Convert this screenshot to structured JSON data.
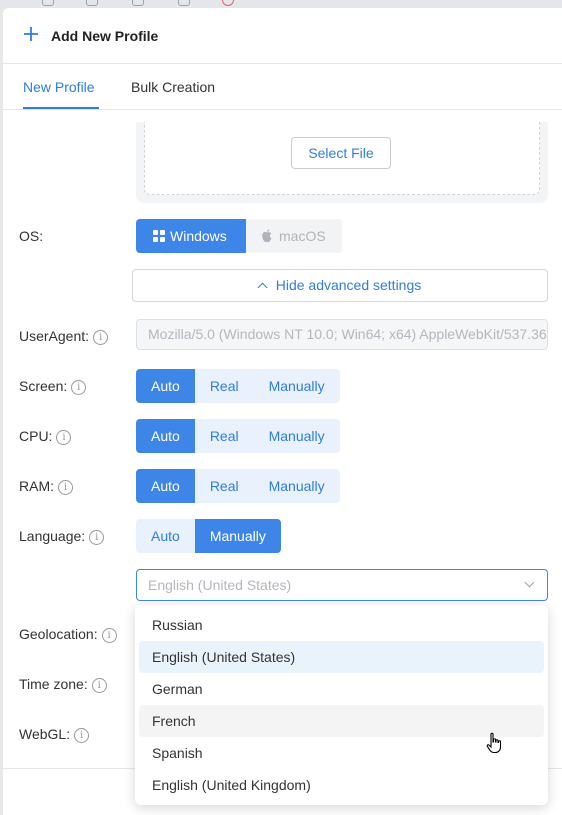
{
  "header": {
    "title": "Add New Profile",
    "icon": "plus-icon",
    "accent": "#2f7de1"
  },
  "tabs": [
    {
      "label": "New Profile",
      "active": true
    },
    {
      "label": "Bulk Creation",
      "active": false
    }
  ],
  "upload": {
    "button_label": "Select File"
  },
  "os": {
    "label": "OS:",
    "options": [
      {
        "label": "Windows",
        "icon": "windows-icon",
        "selected": true
      },
      {
        "label": "macOS",
        "icon": "apple-icon",
        "selected": false
      }
    ]
  },
  "advanced": {
    "label": "Hide advanced settings",
    "icon": "chevron-up-icon"
  },
  "useragent": {
    "label": "UserAgent:",
    "value": "Mozilla/5.0 (Windows NT 10.0; Win64; x64) AppleWebKit/537.36"
  },
  "screen": {
    "label": "Screen:",
    "options": [
      "Auto",
      "Real",
      "Manually"
    ],
    "selected": "Auto"
  },
  "cpu": {
    "label": "CPU:",
    "options": [
      "Auto",
      "Real",
      "Manually"
    ],
    "selected": "Auto"
  },
  "ram": {
    "label": "RAM:",
    "options": [
      "Auto",
      "Real",
      "Manually"
    ],
    "selected": "Auto"
  },
  "language": {
    "label": "Language:",
    "options": [
      "Auto",
      "Manually"
    ],
    "selected": "Manually",
    "select_value": "English (United States)",
    "dropdown": [
      "Russian",
      "English (United States)",
      "German",
      "French",
      "Spanish",
      "English (United Kingdom)"
    ],
    "dropdown_selected": "English (United States)",
    "dropdown_hovered": "French"
  },
  "geolocation": {
    "label": "Geolocation:"
  },
  "timezone": {
    "label": "Time zone:"
  },
  "webgl": {
    "label": "WebGL:"
  },
  "info_icon": {
    "glyph": "i",
    "name": "info-icon"
  }
}
